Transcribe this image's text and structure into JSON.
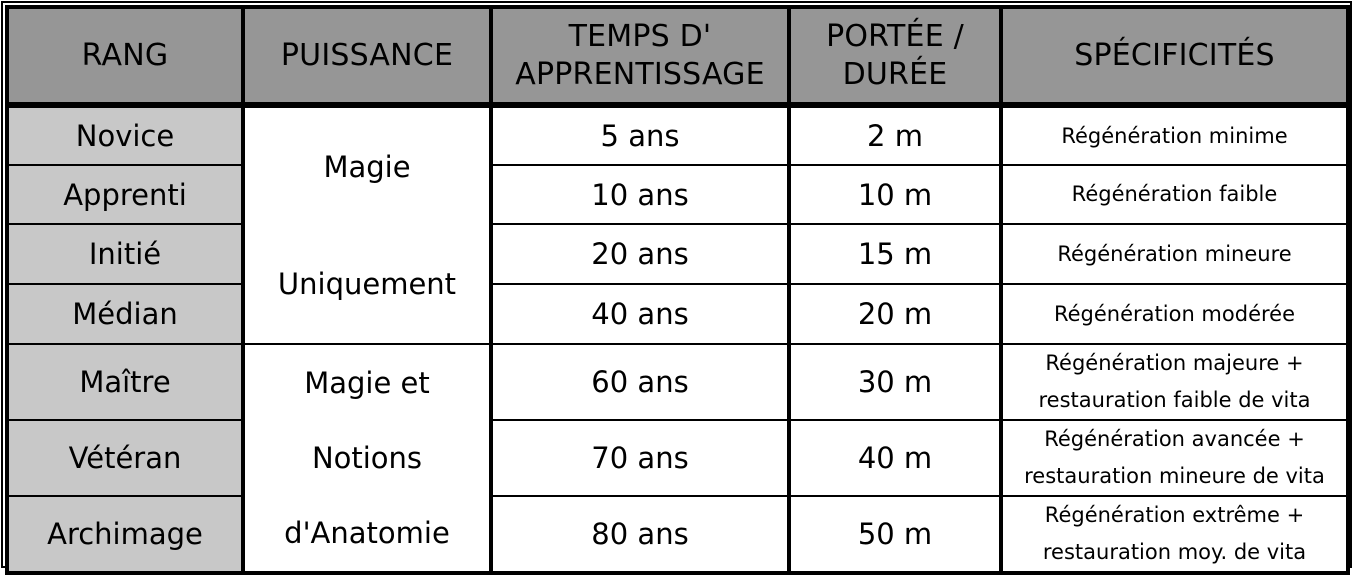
{
  "table": {
    "headers": [
      "RANG",
      "PUISSANCE",
      "TEMPS D' APPRENTISSAGE",
      "PORTÉE / DURÉE",
      "SPÉCIFICITÉS"
    ],
    "header_lines": {
      "temps": [
        "TEMPS D'",
        "APPRENTISSAGE"
      ],
      "portee": [
        "PORTÉE /",
        "DURÉE"
      ]
    },
    "puissance_groups": [
      {
        "lines": [
          "Magie",
          "Uniquement"
        ],
        "rows": 4
      },
      {
        "lines": [
          "Magie et",
          "Notions",
          "d'Anatomie"
        ],
        "rows": 3
      }
    ],
    "rows": [
      {
        "rang": "Novice",
        "temps": "5 ans",
        "portee": "2 m",
        "spec": [
          "Régénération minime"
        ]
      },
      {
        "rang": "Apprenti",
        "temps": "10 ans",
        "portee": "10 m",
        "spec": [
          "Régénération faible"
        ]
      },
      {
        "rang": "Initié",
        "temps": "20 ans",
        "portee": "15 m",
        "spec": [
          "Régénération mineure"
        ]
      },
      {
        "rang": "Médian",
        "temps": "40 ans",
        "portee": "20 m",
        "spec": [
          "Régénération modérée"
        ]
      },
      {
        "rang": "Maître",
        "temps": "60 ans",
        "portee": "30 m",
        "spec": [
          "Régénération majeure +",
          "restauration faible de vita"
        ]
      },
      {
        "rang": "Vétéran",
        "temps": "70 ans",
        "portee": "40 m",
        "spec": [
          "Régénération avancée +",
          "restauration mineure de vita"
        ]
      },
      {
        "rang": "Archimage",
        "temps": "80 ans",
        "portee": "50 m",
        "spec": [
          "Régénération extrême +",
          "restauration moy. de vita"
        ]
      }
    ],
    "colors": {
      "header_bg": "#969696",
      "rang_bg": "#c8c8c8",
      "cell_bg": "#ffffff",
      "border": "#000000"
    }
  }
}
